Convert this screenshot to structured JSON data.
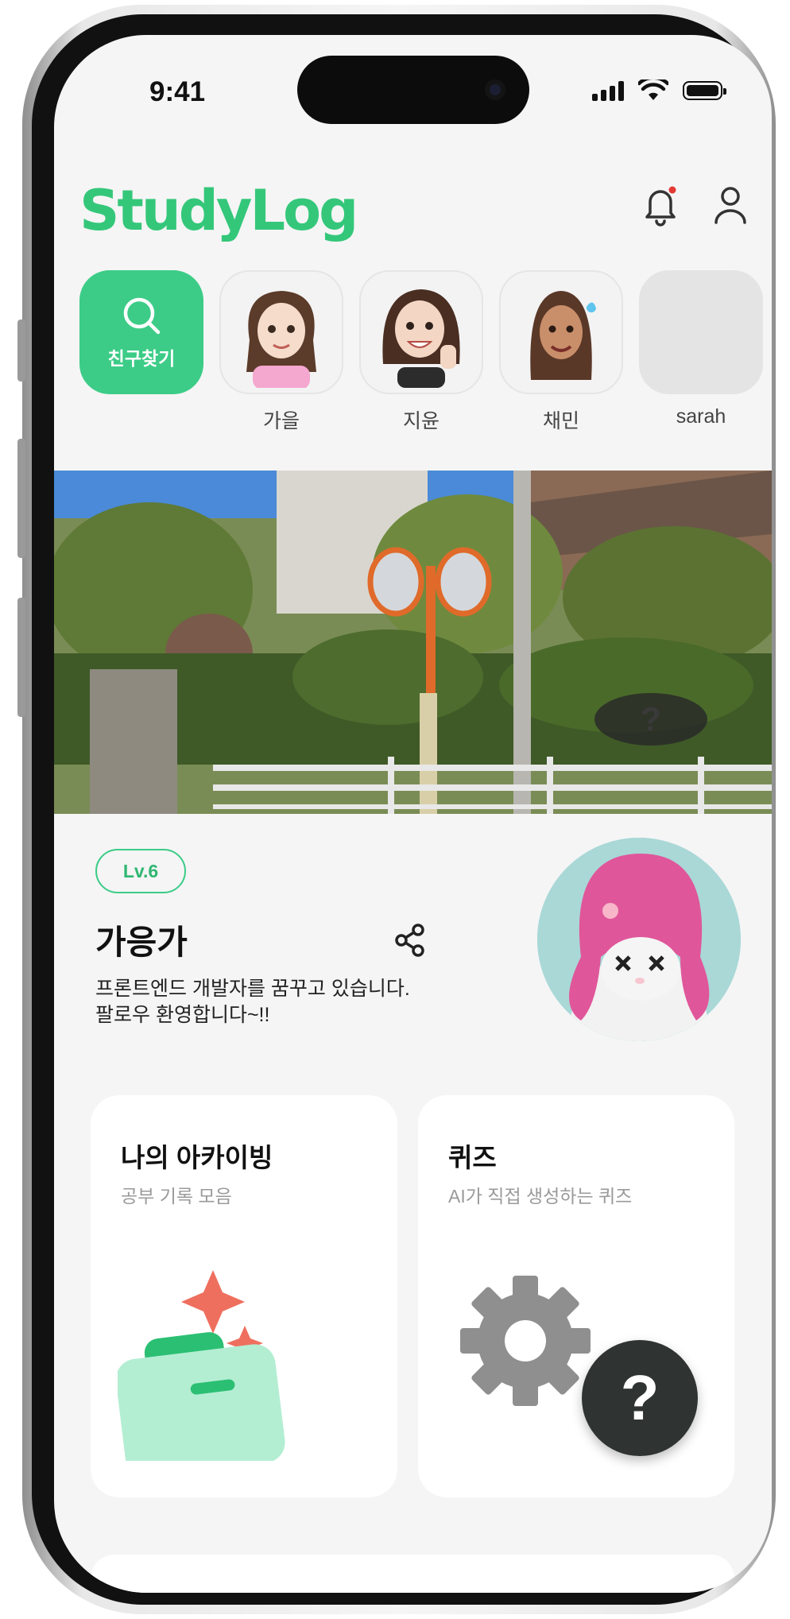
{
  "status": {
    "time": "9:41"
  },
  "header": {
    "logo": "StudyLog",
    "notification_icon": "bell-icon",
    "profile_icon": "user-icon"
  },
  "friends": {
    "find_label": "친구찾기",
    "items": [
      {
        "name": "가을"
      },
      {
        "name": "지윤"
      },
      {
        "name": "채민"
      },
      {
        "name": "sarah"
      }
    ]
  },
  "banner": {
    "hint_label": "?"
  },
  "profile": {
    "level": "Lv.6",
    "name": "가응가",
    "bio_line1": "프론트엔드 개발자를 꿈꾸고 있습니다.",
    "bio_line2": "팔로우 환영합니다~!!"
  },
  "cards": [
    {
      "title": "나의 아카이빙",
      "subtitle": "공부 기록 모음",
      "icon": "folder-sparkle-icon"
    },
    {
      "title": "퀴즈",
      "subtitle": "AI가 직접 생성하는 퀴즈",
      "icon": "gear-icon"
    }
  ],
  "fab": {
    "label": "?"
  },
  "colors": {
    "accent": "#3ccc87",
    "background": "#f5f5f5",
    "notification_dot": "#e53935"
  }
}
